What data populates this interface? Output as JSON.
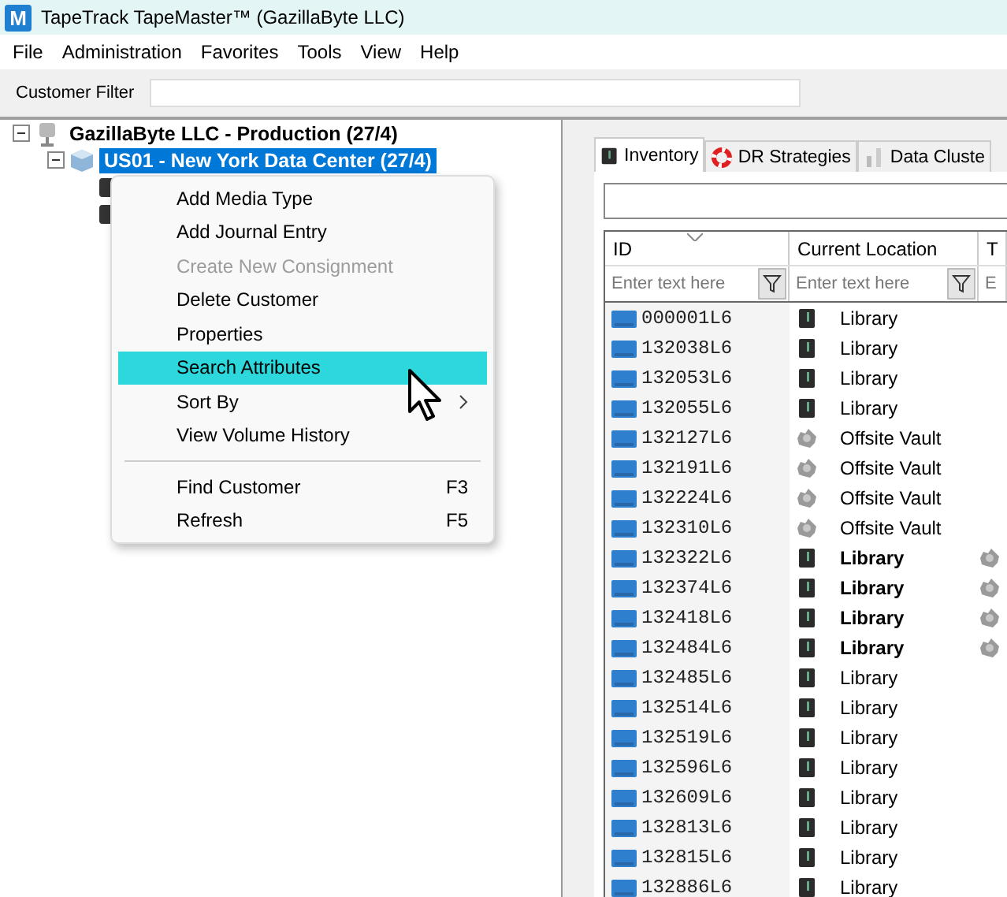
{
  "window": {
    "title": "TapeTrack TapeMaster™ (GazillaByte LLC)",
    "icon_letter": "M"
  },
  "menu_bar": [
    "File",
    "Administration",
    "Favorites",
    "Tools",
    "View",
    "Help"
  ],
  "toolbar": {
    "label": "Customer Filter"
  },
  "tree": [
    {
      "label": "GazillaByte LLC - Production (27/4)",
      "selected": false,
      "expanded": true,
      "children": [
        {
          "label": "US01 - New York Data Center (27/4)",
          "selected": true,
          "expanded": true,
          "children": [
            {
              "selected": false
            },
            {
              "selected": false
            }
          ]
        }
      ]
    }
  ],
  "context_menu": [
    {
      "kind": "item",
      "label": "Add Media Type",
      "disabled": false,
      "selected": false
    },
    {
      "kind": "item",
      "label": "Add Journal Entry",
      "disabled": false,
      "selected": false
    },
    {
      "kind": "item",
      "label": "Create New Consignment",
      "disabled": true,
      "selected": false
    },
    {
      "kind": "item",
      "label": "Delete Customer",
      "disabled": false,
      "selected": false
    },
    {
      "kind": "item",
      "label": "Properties",
      "disabled": false,
      "selected": false
    },
    {
      "kind": "item",
      "label": "Search Attributes",
      "disabled": false,
      "selected": true
    },
    {
      "kind": "submenu",
      "label": "Sort By",
      "disabled": false,
      "selected": false
    },
    {
      "kind": "item",
      "label": "View Volume History",
      "disabled": false,
      "selected": false
    },
    {
      "kind": "separator"
    },
    {
      "kind": "item",
      "label": "Find Customer",
      "shortcut": "F3",
      "disabled": false,
      "selected": false
    },
    {
      "kind": "item",
      "label": "Refresh",
      "shortcut": "F5",
      "disabled": false,
      "selected": false
    }
  ],
  "tabs": [
    {
      "label": "Inventory",
      "kind": "tape",
      "selected": true
    },
    {
      "label": "DR Strategies",
      "kind": "lifebuoy",
      "selected": false
    },
    {
      "label": "Data Cluste",
      "kind": "cluster",
      "selected": false
    }
  ],
  "table": {
    "columns": [
      "ID",
      "Current Location",
      "T"
    ],
    "placeholders": [
      "Enter text here",
      "Enter text here",
      "E"
    ],
    "rows": [
      {
        "id": "000001L6",
        "location": "Library",
        "kind": "library",
        "bold": false,
        "column_3_icon": false
      },
      {
        "id": "132038L6",
        "location": "Library",
        "kind": "library",
        "bold": false,
        "column_3_icon": false
      },
      {
        "id": "132053L6",
        "location": "Library",
        "kind": "library",
        "bold": false,
        "column_3_icon": false
      },
      {
        "id": "132055L6",
        "location": "Library",
        "kind": "library",
        "bold": false,
        "column_3_icon": false
      },
      {
        "id": "132127L6",
        "location": "Offsite Vault",
        "kind": "offsite",
        "bold": false,
        "column_3_icon": false
      },
      {
        "id": "132191L6",
        "location": "Offsite Vault",
        "kind": "offsite",
        "bold": false,
        "column_3_icon": false
      },
      {
        "id": "132224L6",
        "location": "Offsite Vault",
        "kind": "offsite",
        "bold": false,
        "column_3_icon": false
      },
      {
        "id": "132310L6",
        "location": "Offsite Vault",
        "kind": "offsite",
        "bold": false,
        "column_3_icon": false
      },
      {
        "id": "132322L6",
        "location": "Library",
        "kind": "library",
        "bold": true,
        "column_3_icon": true
      },
      {
        "id": "132374L6",
        "location": "Library",
        "kind": "library",
        "bold": true,
        "column_3_icon": true
      },
      {
        "id": "132418L6",
        "location": "Library",
        "kind": "library",
        "bold": true,
        "column_3_icon": true
      },
      {
        "id": "132484L6",
        "location": "Library",
        "kind": "library",
        "bold": true,
        "column_3_icon": true
      },
      {
        "id": "132485L6",
        "location": "Library",
        "kind": "library",
        "bold": false,
        "column_3_icon": false
      },
      {
        "id": "132514L6",
        "location": "Library",
        "kind": "library",
        "bold": false,
        "column_3_icon": false
      },
      {
        "id": "132519L6",
        "location": "Library",
        "kind": "library",
        "bold": false,
        "column_3_icon": false
      },
      {
        "id": "132596L6",
        "location": "Library",
        "kind": "library",
        "bold": false,
        "column_3_icon": false
      },
      {
        "id": "132609L6",
        "location": "Library",
        "kind": "library",
        "bold": false,
        "column_3_icon": false
      },
      {
        "id": "132813L6",
        "location": "Library",
        "kind": "library",
        "bold": false,
        "column_3_icon": false
      },
      {
        "id": "132815L6",
        "location": "Library",
        "kind": "library",
        "bold": false,
        "column_3_icon": false
      },
      {
        "id": "132886L6",
        "location": "Library",
        "kind": "library",
        "bold": false,
        "column_3_icon": false
      }
    ]
  }
}
